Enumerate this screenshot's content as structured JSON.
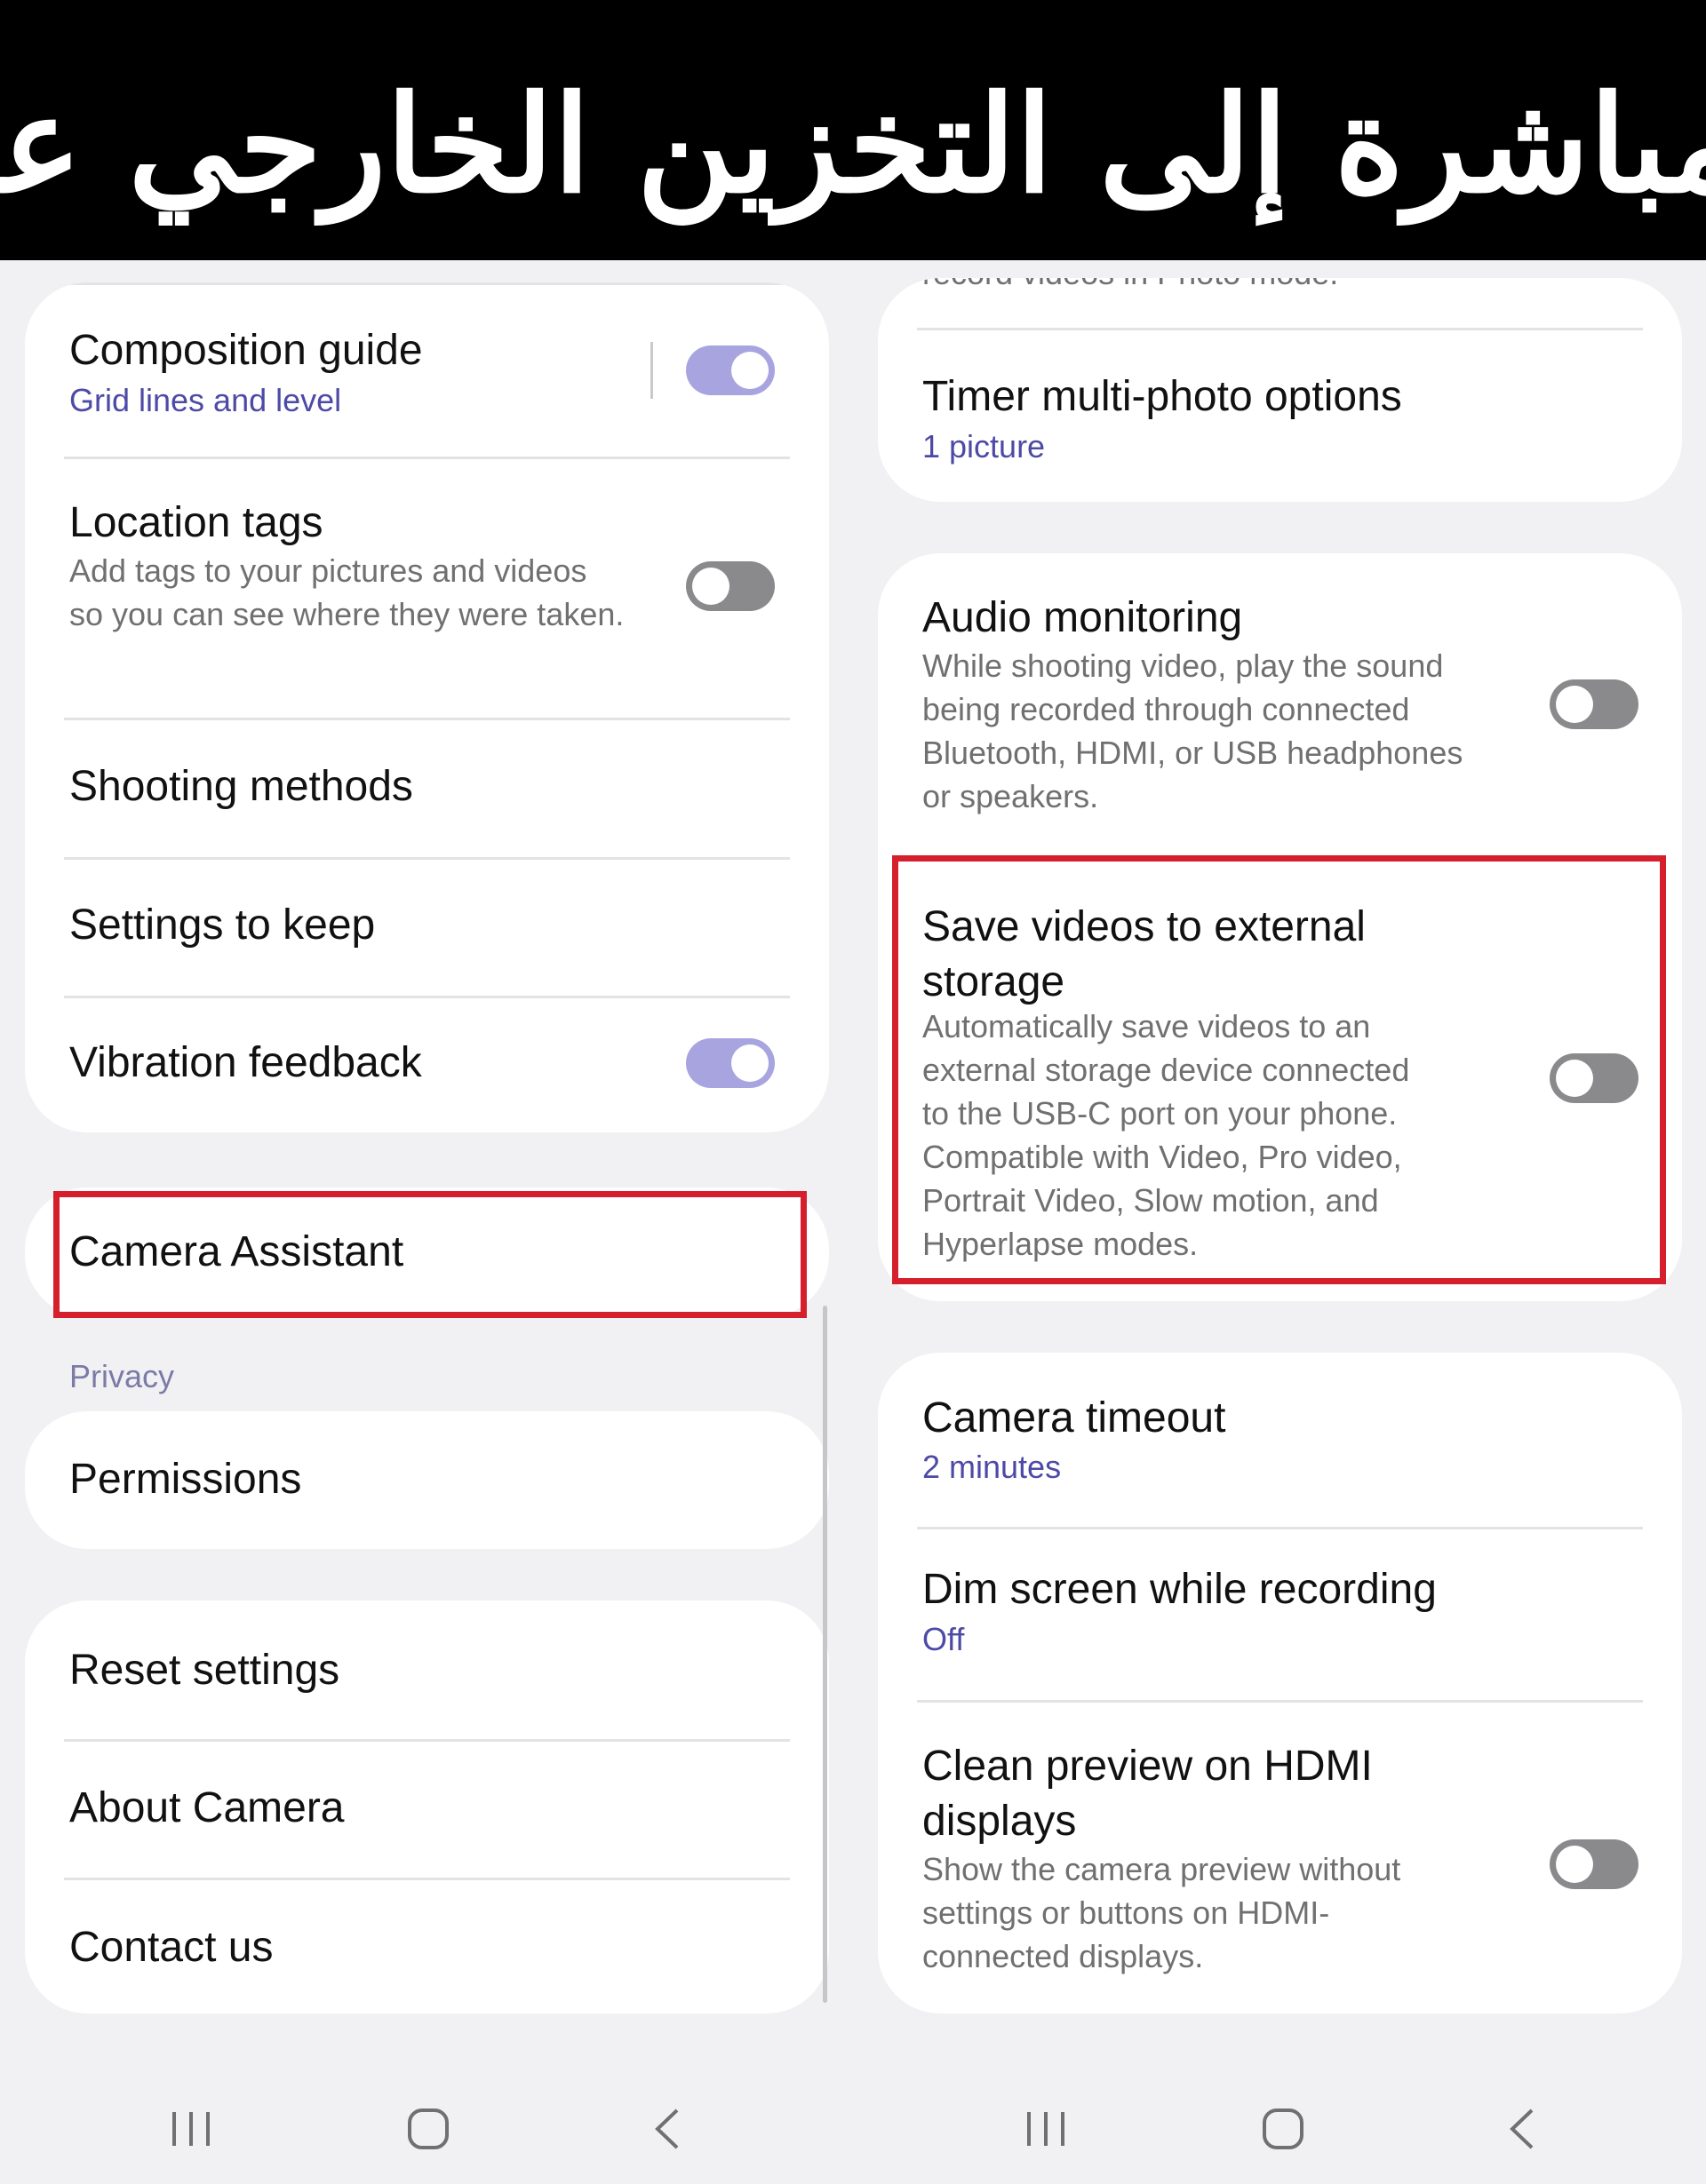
{
  "banner": {
    "text": "مباشرة إلى التخزين الخارجي على هو"
  },
  "left": {
    "card1": {
      "composition": {
        "title": "Composition guide",
        "subtitle": "Grid lines and level",
        "toggle": "on"
      },
      "location": {
        "title": "Location tags",
        "desc": "Add tags to your pictures and videos so you can see where they were taken.",
        "toggle": "off"
      },
      "shooting": {
        "title": "Shooting methods"
      },
      "keep": {
        "title": "Settings to keep"
      },
      "vibration": {
        "title": "Vibration feedback",
        "toggle": "on"
      }
    },
    "camera_assistant": {
      "title": "Camera Assistant"
    },
    "privacy": {
      "label": "Privacy",
      "permissions": "Permissions"
    },
    "card4": {
      "reset": "Reset settings",
      "about": "About Camera",
      "contact": "Contact us"
    }
  },
  "right": {
    "cut_text": "record videos in Photo mode.",
    "timer": {
      "title": "Timer multi-photo options",
      "subtitle": "1 picture"
    },
    "audio": {
      "title": "Audio monitoring",
      "desc": "While shooting video, play the sound being recorded through connected Bluetooth, HDMI, or USB headphones or speakers.",
      "toggle": "off"
    },
    "save_external": {
      "title": "Save videos to external storage",
      "desc": "Automatically save videos to an external storage device connected to the USB-C port on your phone. Compatible with Video, Pro video, Portrait Video, Slow motion, and Hyperlapse modes.",
      "toggle": "off"
    },
    "timeout": {
      "title": "Camera timeout",
      "subtitle": "2 minutes"
    },
    "dim": {
      "title": "Dim screen while recording",
      "subtitle": "Off"
    },
    "clean": {
      "title": "Clean preview on HDMI displays",
      "desc": "Show the camera preview without settings or buttons on HDMI-connected displays.",
      "toggle": "off"
    }
  },
  "nav": {
    "recents_icon": "recents-icon",
    "home_icon": "home-icon",
    "back_icon": "back-icon"
  },
  "colors": {
    "accent": "#4d4aa6",
    "toggle_on": "#a8a4e0",
    "toggle_off": "#8a8a8d",
    "highlight": "#d61f2c"
  }
}
